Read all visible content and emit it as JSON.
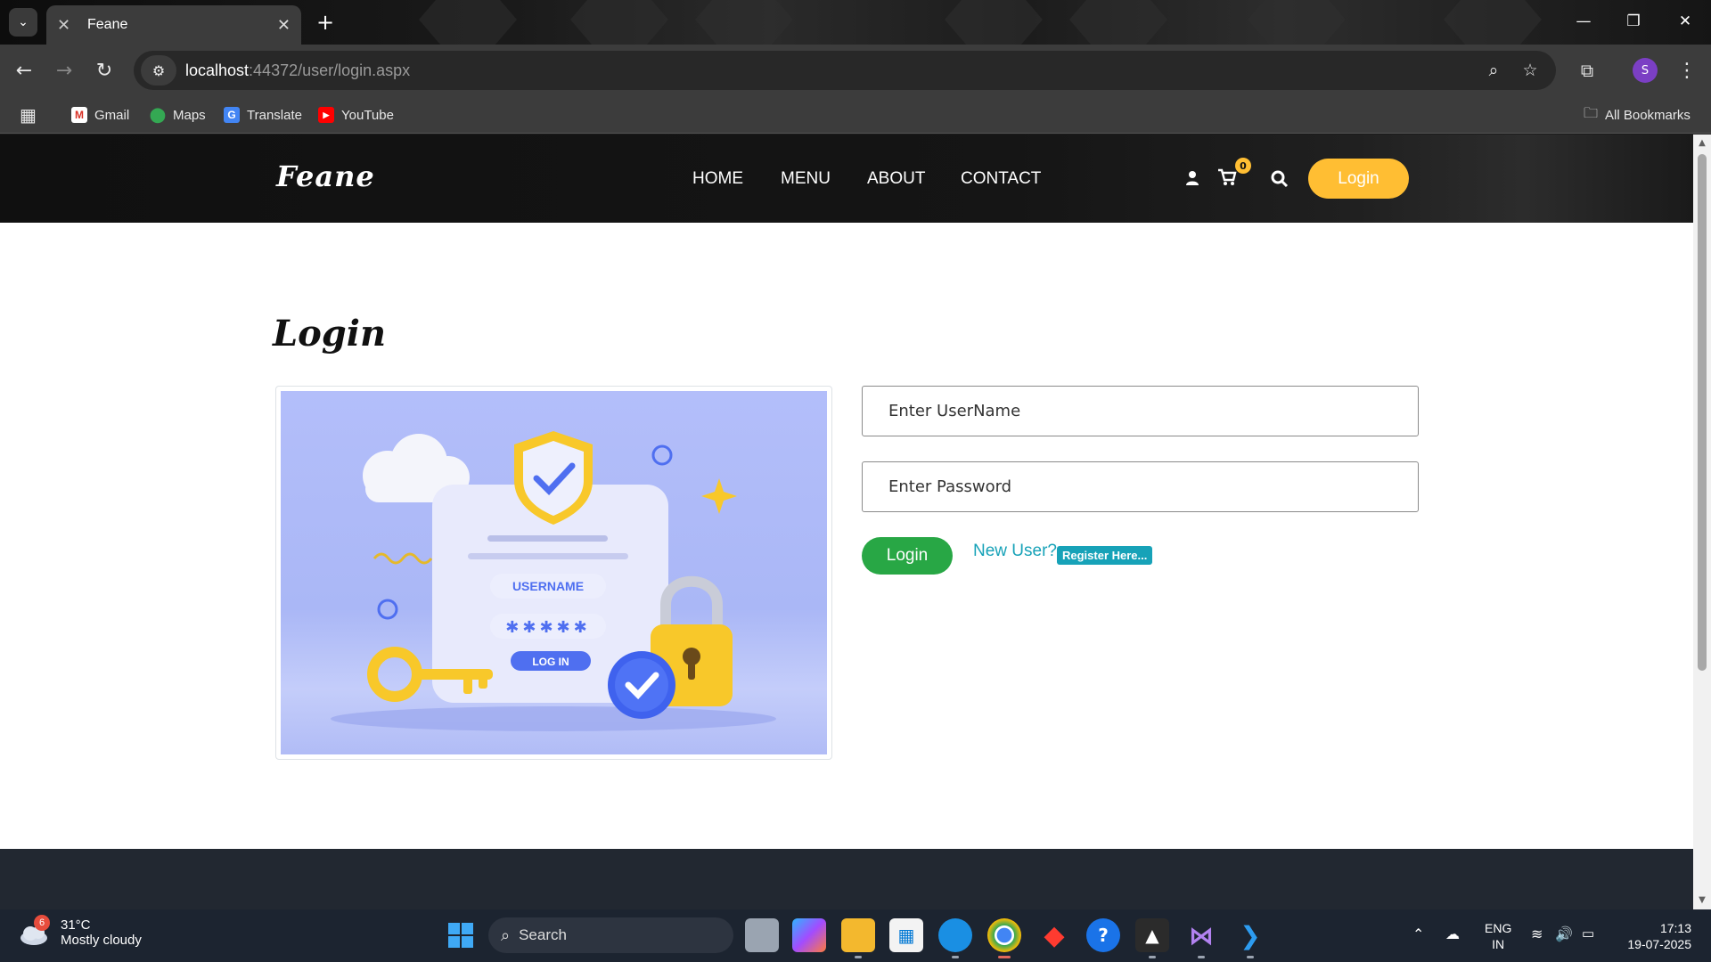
{
  "browser": {
    "tab_title": "Feane",
    "url_host": "localhost",
    "url_rest": ":44372/user/login.aspx",
    "bookmarks": [
      "Gmail",
      "Maps",
      "Translate",
      "YouTube"
    ],
    "all_bookmarks": "All Bookmarks",
    "profile_initial": "S"
  },
  "site": {
    "brand": "Feane",
    "nav": [
      "HOME",
      "MENU",
      "ABOUT",
      "CONTACT"
    ],
    "cart_count": "0",
    "header_login": "Login",
    "accent": "#ffbe33"
  },
  "login": {
    "title": "Login",
    "username_placeholder": "Enter UserName",
    "password_placeholder": "Enter Password",
    "submit_label": "Login",
    "new_user_text": "New User?",
    "register_label": "Register Here..."
  },
  "illustration": {
    "username_label": "USERNAME",
    "password_mask": "✱✱✱✱✱",
    "login_label": "LOG IN"
  },
  "taskbar": {
    "weather_badge": "6",
    "temperature": "31°C",
    "condition": "Mostly cloudy",
    "search_label": "Search",
    "language": "ENG",
    "region": "IN",
    "time": "17:13",
    "date": "19-07-2025"
  }
}
